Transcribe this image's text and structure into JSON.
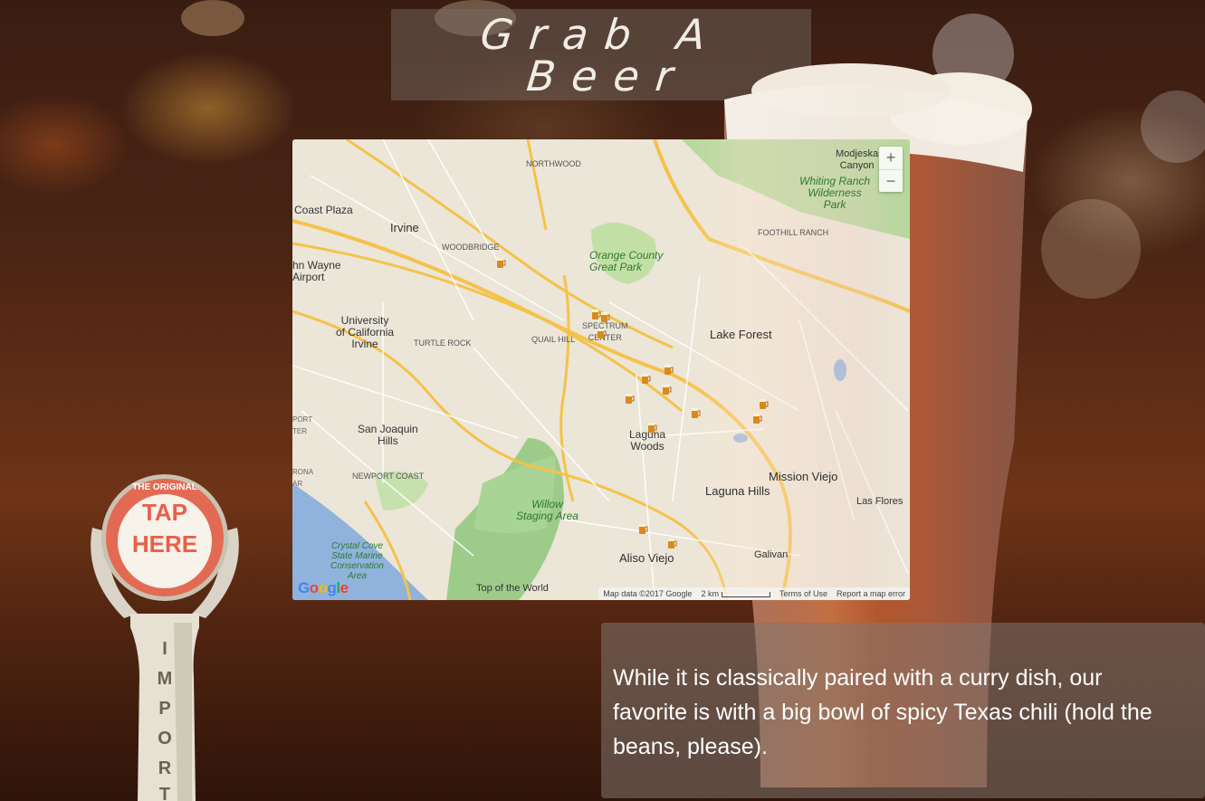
{
  "title": {
    "line1": "Grab A",
    "line2": "Beer"
  },
  "map": {
    "labels": {
      "irvine": "Irvine",
      "coast_plaza": "Coast Plaza",
      "john_wayne": "hn Wayne\nAirport",
      "university": "University\nof California\nIrvine",
      "turtle_rock": "TURTLE ROCK",
      "quail_hill": "QUAIL HILL",
      "woodbridge": "WOODBRIDGE",
      "northwood": "NORTHWOOD",
      "spectrum": "SPECTRUM\nCENTER",
      "orange_county_park": "Orange County\nGreat Park",
      "foothill_ranch": "FOOTHILL RANCH",
      "whiting_ranch": "Whiting Ranch\nWilderness\nPark",
      "modjeska": "Modjeska\nCanyon",
      "lake_forest": "Lake Forest",
      "san_joaquin": "San Joaquin\nHills",
      "newport_coast": "NEWPORT COAST",
      "laguna_woods": "Laguna\nWoods",
      "laguna_hills": "Laguna Hills",
      "mission_viejo": "Mission Viejo",
      "las_flores": "Las Flores",
      "willow": "Willow\nStaging Area",
      "crystal_cove": "Crystal Cove\nState Marine\nConservation\nArea",
      "aliso_viejo": "Aliso Viejo",
      "galivan": "Galivan",
      "top_of_world": "Top of the World",
      "port": "PORT\nTER",
      "rona": "RONA\nAR"
    },
    "zoom_in": "+",
    "zoom_out": "−",
    "google": [
      "G",
      "o",
      "o",
      "g",
      "l",
      "e"
    ],
    "footer": {
      "map_data": "Map data ©2017 Google",
      "scale": "2 km",
      "terms": "Terms of Use",
      "report": "Report a map error"
    }
  },
  "description": "While it is classically paired with a curry dish, our favorite is with a big bowl of spicy Texas chili (hold the beans, please).",
  "tap": {
    "top_ring": "THE ORIGINAL",
    "label_line1": "TAP",
    "label_line2": "HERE",
    "handle": [
      "I",
      "M",
      "P",
      "O",
      "R",
      "T"
    ]
  },
  "colors": {
    "tap_red": "#e8604a",
    "panel": "#7f746f",
    "beer": "#a4421c"
  }
}
